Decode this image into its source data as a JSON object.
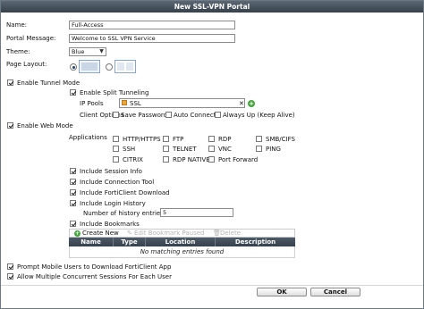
{
  "window": {
    "title": "New SSL-VPN Portal"
  },
  "form": {
    "name_label": "Name:",
    "name_value": "Full-Access",
    "message_label": "Portal Message:",
    "message_value": "Welcome to SSL VPN Service",
    "theme_label": "Theme:",
    "theme_value": "Blue",
    "layout_label": "Page Layout:",
    "layout_option_1_selected": true,
    "layout_option_2_selected": false
  },
  "tunnel": {
    "enable_label": "Enable Tunnel Mode",
    "enable_checked": true,
    "split_label": "Enable Split Tunneling",
    "split_checked": true,
    "ip_pools_label": "IP Pools",
    "ip_pool_chip": "SSL",
    "client_options_label": "Client Options",
    "save_password": "Save Password",
    "auto_connect": "Auto Connect",
    "always_up": "Always Up (Keep Alive)"
  },
  "web": {
    "enable_label": "Enable Web Mode",
    "enable_checked": true,
    "applications_label": "Applications",
    "apps": [
      {
        "label": "HTTP/HTTPS",
        "checked": false
      },
      {
        "label": "FTP",
        "checked": false
      },
      {
        "label": "RDP",
        "checked": false
      },
      {
        "label": "SMB/CIFS",
        "checked": false
      },
      {
        "label": "SSH",
        "checked": false
      },
      {
        "label": "TELNET",
        "checked": false
      },
      {
        "label": "VNC",
        "checked": false
      },
      {
        "label": "PING",
        "checked": false
      },
      {
        "label": "CITRIX",
        "checked": false
      },
      {
        "label": "RDP NATIVE",
        "checked": false
      },
      {
        "label": "Port Forward",
        "checked": false
      }
    ],
    "include_session_info": "Include Session Info",
    "include_connection_tool": "Include Connection Tool",
    "include_forticlient": "Include FortiClient Download",
    "include_login_history": "Include Login History",
    "history_entries_label": "Number of history entries:",
    "history_entries_value": "5",
    "include_bookmarks": "Include Bookmarks"
  },
  "bookmarks": {
    "create_new": "Create New",
    "edit": "Edit Bookmark Paused",
    "delete": "Delete",
    "columns": [
      "Name",
      "Type",
      "Location",
      "Description"
    ],
    "empty_text": "No matching entries found"
  },
  "footer": {
    "prompt_mobile": "Prompt Mobile Users to Download FortiClient App",
    "allow_multiple": "Allow Multiple Concurrent Sessions For Each User",
    "ok": "OK",
    "cancel": "Cancel"
  },
  "colors": {
    "titlebar": "#3e4954",
    "grid_header": "#414d59",
    "layout_selected": "#c9d6e6"
  }
}
